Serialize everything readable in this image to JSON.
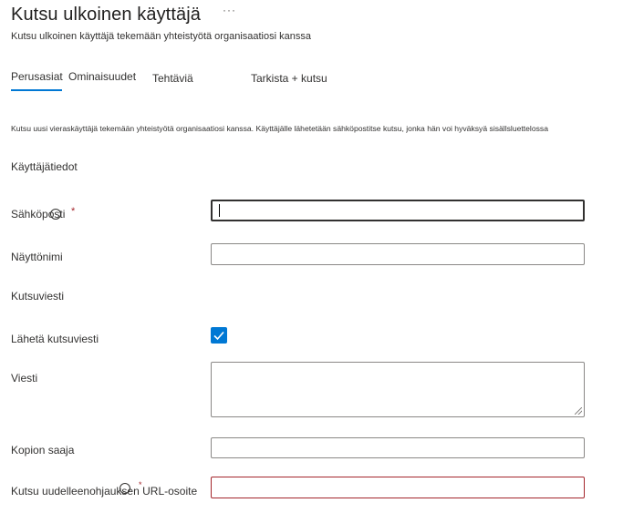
{
  "header": {
    "title": "Kutsu ulkoinen käyttäjä",
    "more_label": "···",
    "subtitle": "Kutsu ulkoinen käyttäjä tekemään yhteistyötä organisaatiosi kanssa"
  },
  "tabs": [
    {
      "label": "Perusasiat",
      "active": true
    },
    {
      "label": "Ominaisuudet",
      "active": false
    },
    {
      "label": "Tehtäviä",
      "active": false
    },
    {
      "label": "Tarkista + kutsu",
      "active": false
    }
  ],
  "intro_text": "Kutsu uusi vieraskäyttäjä tekemään yhteistyötä organisaatiosi kanssa. Käyttäjälle lähetetään sähköpostitse kutsu, jonka hän voi hyväksyä sisällsluettelossa",
  "sections": {
    "user_info": "Käyttäjätiedot",
    "invitation": "Kutsuviesti"
  },
  "form": {
    "email": {
      "label": "Sähköposti",
      "required_mark": "*",
      "value": ""
    },
    "display_name": {
      "label": "Näyttönimi",
      "value": ""
    },
    "send_invite": {
      "label": "Lähetä kutsuviesti",
      "checked": true
    },
    "message": {
      "label": "Viesti",
      "value": ""
    },
    "cc": {
      "label": "Kopion saaja",
      "value": ""
    },
    "redirect_url": {
      "label": "Kutsu uudelleenohjauksen URL-osoite",
      "required_mark": "*",
      "value": ""
    }
  },
  "colors": {
    "accent": "#0078d4",
    "error_border": "#a4262c",
    "text": "#323130"
  }
}
